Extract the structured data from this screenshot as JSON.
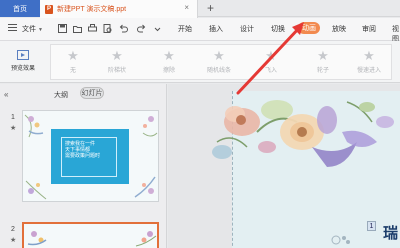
{
  "titlebar": {
    "home_label": "首页",
    "doc_tab_label": "新建PPT 演示文稿.ppt",
    "doc_icon_letter": "P",
    "close_symbol": "×",
    "add_symbol": "+"
  },
  "menubar": {
    "file_label": "文件",
    "file_arrow": "▼",
    "quick_access_icons": [
      "save-icon",
      "undo-icon",
      "print-icon",
      "preview-icon",
      "undo-arrow-icon",
      "redo-arrow-icon"
    ],
    "items": [
      "开始",
      "插入",
      "设计",
      "切换",
      "动画",
      "放映",
      "审阅",
      "视图"
    ],
    "active_item": "动画",
    "accent_color": "#f28a4f"
  },
  "ribbon": {
    "preview_label": "预览效果",
    "effects": [
      "无",
      "阶梯状",
      "擦除",
      "随机线条",
      "飞入",
      "轮子",
      "慢速进入"
    ]
  },
  "left_pane": {
    "collapse_symbol": "«",
    "outline_tab": "大纲",
    "slides_tab": "幻灯片",
    "slides": [
      {
        "number": "1",
        "star": "★",
        "board_lines": [
          "搜索我在一件",
          "天下事情都",
          "需要政策问题时"
        ]
      },
      {
        "number": "2",
        "star": "★"
      }
    ]
  },
  "editor": {
    "page_number": "1",
    "title_fragment": "瑞"
  },
  "colors": {
    "home_tab": "#3f6fc6",
    "doc_tab_text": "#d9541e",
    "arrow": "#e53935",
    "selected_slide_border": "#e2703a"
  }
}
